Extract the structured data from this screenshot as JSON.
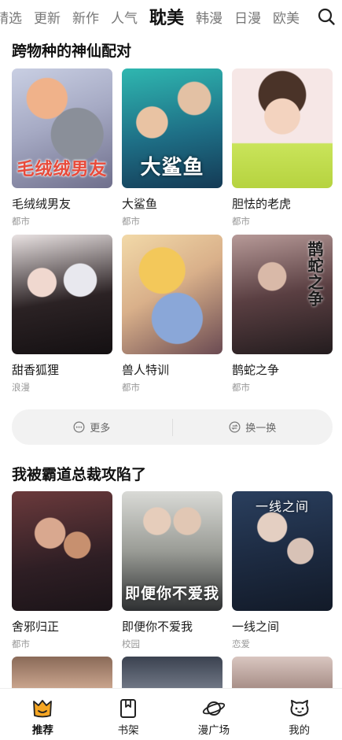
{
  "tabs": [
    "精选",
    "更新",
    "新作",
    "人气",
    "耽美",
    "韩漫",
    "日漫",
    "欧美"
  ],
  "tabs_display": [
    "精选",
    "更新",
    "新作",
    "人气",
    "耽美",
    "韩漫",
    "日漫",
    "欧美"
  ],
  "active_tab": "耽美",
  "section1": {
    "title": "跨物种的神仙配对",
    "items": [
      {
        "title": "毛绒绒男友",
        "genre": "都市",
        "cover_text": "毛绒绒男友"
      },
      {
        "title": "大鲨鱼",
        "genre": "都市",
        "cover_text": "大鲨鱼"
      },
      {
        "title": "胆怯的老虎",
        "genre": "都市",
        "cover_text": ""
      },
      {
        "title": "甜香狐狸",
        "genre": "浪漫",
        "cover_text": ""
      },
      {
        "title": "兽人特训",
        "genre": "都市",
        "cover_text": ""
      },
      {
        "title": "鹊蛇之争",
        "genre": "都市",
        "cover_text": "鹊蛇之争"
      }
    ]
  },
  "more_bar": {
    "more_label": "更多",
    "shuffle_label": "换一换"
  },
  "section2": {
    "title": "我被霸道总裁攻陷了",
    "items": [
      {
        "title": "舍邪归正",
        "genre": "都市",
        "cover_text": ""
      },
      {
        "title": "即便你不爱我",
        "genre": "校园",
        "cover_text": "即便你不爱我"
      },
      {
        "title": "一线之间",
        "genre": "恋爱",
        "cover_text": "一线之间"
      }
    ]
  },
  "bottom_nav": [
    {
      "label": "推荐",
      "icon": "recommend-icon"
    },
    {
      "label": "书架",
      "icon": "bookshelf-icon"
    },
    {
      "label": "漫广场",
      "icon": "planet-icon"
    },
    {
      "label": "我的",
      "icon": "profile-icon"
    }
  ],
  "colors": {
    "accent": "#f5a623",
    "text": "#222222",
    "muted": "#999999"
  }
}
